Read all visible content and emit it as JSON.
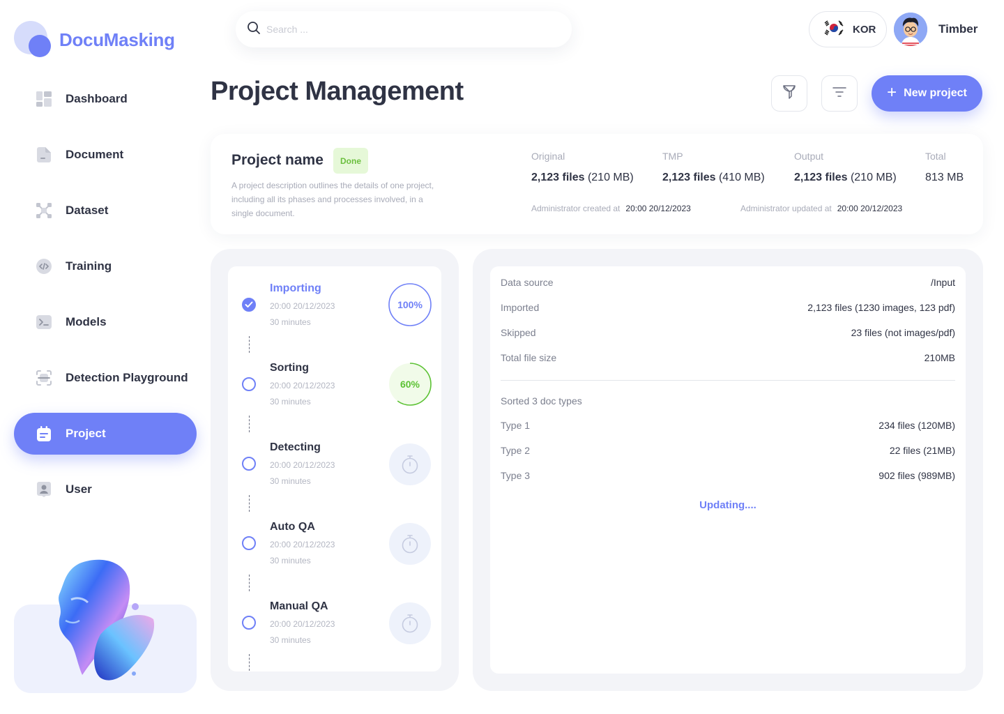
{
  "app": {
    "name": "DocuMasking",
    "accent": "#6f80f7"
  },
  "sidebar": {
    "items": [
      {
        "label": "Dashboard",
        "icon": "dashboard-icon"
      },
      {
        "label": "Document",
        "icon": "document-icon"
      },
      {
        "label": "Dataset",
        "icon": "dataset-icon"
      },
      {
        "label": "Training",
        "icon": "training-icon"
      },
      {
        "label": "Models",
        "icon": "models-icon"
      },
      {
        "label": "Detection Playground",
        "icon": "detection-icon"
      },
      {
        "label": "Project",
        "icon": "project-icon",
        "active": true
      },
      {
        "label": "User",
        "icon": "user-icon"
      }
    ]
  },
  "topbar": {
    "search_placeholder": "Search ...",
    "language": "KOR",
    "language_flag_icon": "korea-flag-icon",
    "user_name": "Timber"
  },
  "header": {
    "title": "Project Management",
    "new_project_label": "New project"
  },
  "project": {
    "name": "Project name",
    "status": "Done",
    "description": "A project description outlines the details of one project, including all its phases and processes involved, in a single document.",
    "stats": [
      {
        "label": "Original",
        "count": "2,123 files",
        "size": "(210 MB)"
      },
      {
        "label": "TMP",
        "count": "2,123 files",
        "size": "(410 MB)"
      },
      {
        "label": "Output",
        "count": "2,123 files",
        "size": "(210 MB)"
      },
      {
        "label": "Total",
        "count": "",
        "size": "813 MB"
      }
    ],
    "created_label": "Administrator created at",
    "created_value": "20:00 20/12/2023",
    "updated_label": "Administrator updated at",
    "updated_value": "20:00 20/12/2023"
  },
  "steps": [
    {
      "title": "Importing",
      "time": "20:00 20/12/2023",
      "duration": "30 minutes",
      "state": "done",
      "progress": 100,
      "progress_label": "100%"
    },
    {
      "title": "Sorting",
      "time": "20:00 20/12/2023",
      "duration": "30 minutes",
      "state": "running",
      "progress": 60,
      "progress_label": "60%"
    },
    {
      "title": "Detecting",
      "time": "20:00 20/12/2023",
      "duration": "30 minutes",
      "state": "pending"
    },
    {
      "title": "Auto QA",
      "time": "20:00 20/12/2023",
      "duration": "30 minutes",
      "state": "pending"
    },
    {
      "title": "Manual QA",
      "time": "20:00 20/12/2023",
      "duration": "30 minutes",
      "state": "pending"
    }
  ],
  "details": {
    "rows": [
      {
        "key": "Data source",
        "value": "/Input"
      },
      {
        "key": "Imported",
        "value": "2,123 files (1230 images, 123 pdf)"
      },
      {
        "key": "Skipped",
        "value": "23 files (not images/pdf)"
      },
      {
        "key": "Total file size",
        "value": "210MB"
      }
    ],
    "sorted_title": "Sorted 3 doc types",
    "types": [
      {
        "key": "Type 1",
        "value": "234 files (120MB)"
      },
      {
        "key": "Type 2",
        "value": "22 files (21MB)"
      },
      {
        "key": "Type 3",
        "value": "902 files (989MB)"
      }
    ],
    "status_text": "Updating...."
  }
}
